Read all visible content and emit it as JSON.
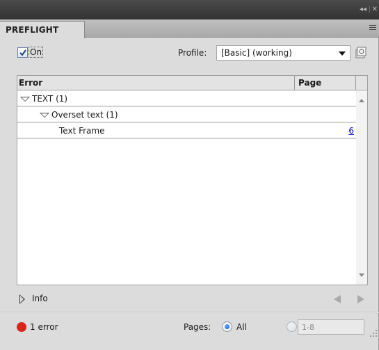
{
  "window": {
    "collapse_glyph": "◂◂",
    "separator_glyph": "|",
    "close_glyph": "✕"
  },
  "panel": {
    "tab_label": "PREFLIGHT",
    "menu_icon": "panel-menu-icon"
  },
  "controls": {
    "on_checked": true,
    "on_label": "On",
    "profile_label": "Profile:",
    "profile_value": "[Basic] (working)"
  },
  "table": {
    "columns": [
      "Error",
      "Page"
    ],
    "rows": [
      {
        "label": "TEXT (1)",
        "level": 0,
        "expanded": true,
        "page": ""
      },
      {
        "label": "Overset text (1)",
        "level": 1,
        "expanded": true,
        "page": ""
      },
      {
        "label": "Text Frame",
        "level": 2,
        "expanded": false,
        "page": "6"
      }
    ]
  },
  "info": {
    "label": "Info"
  },
  "status": {
    "error_text": "1 error",
    "error_color": "#d9261c",
    "pages_label": "Pages:",
    "all_label": "All",
    "all_selected": true,
    "range_value": "1-8"
  }
}
